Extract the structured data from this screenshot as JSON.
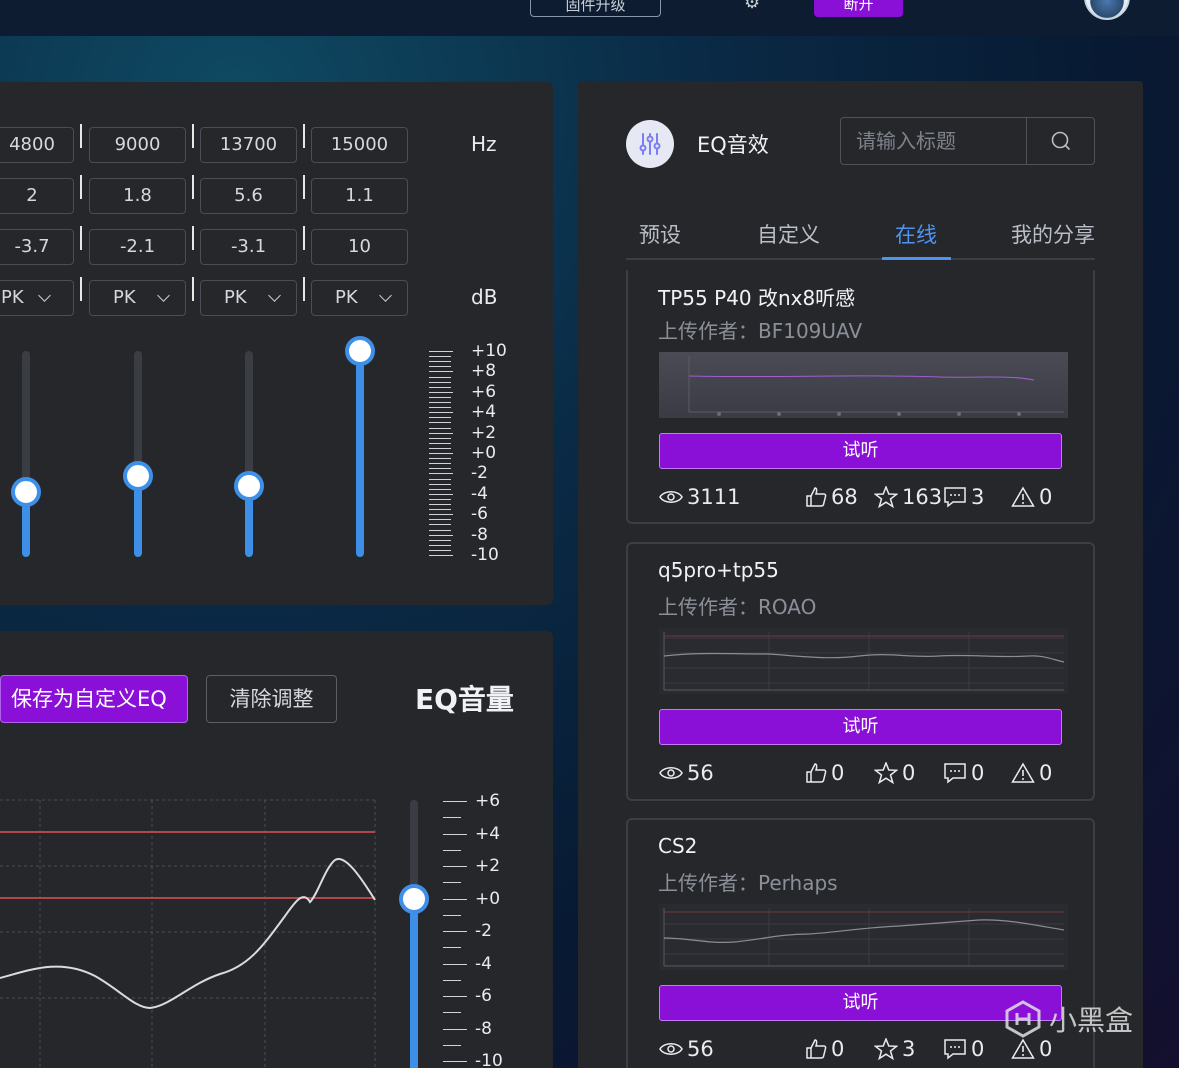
{
  "topbar": {
    "outline_button": "固件升级",
    "purple_button": "断开"
  },
  "eq": {
    "freq": [
      "4800",
      "9000",
      "13700",
      "15000"
    ],
    "q": [
      "2",
      "1.8",
      "5.6",
      "1.1"
    ],
    "gain": [
      "-3.7",
      "-2.1",
      "-3.1",
      "10"
    ],
    "type": [
      "PK",
      "PK",
      "PK",
      "PK"
    ],
    "unit_hz": "Hz",
    "unit_db": "dB",
    "slider_values_db": [
      -3.7,
      -2.1,
      -3.1,
      10
    ],
    "scale": [
      "+10",
      "+8",
      "+6",
      "+4",
      "+2",
      "+0",
      "-2",
      "-4",
      "-6",
      "-8",
      "-10"
    ]
  },
  "volume": {
    "save_button": "保存为自定义EQ",
    "clear_button": "清除调整",
    "title": "EQ音量",
    "scale": [
      "+6",
      "+4",
      "+2",
      "+0",
      "-2",
      "-4",
      "-6",
      "-8",
      "-10"
    ],
    "slider_value_db": 0
  },
  "online": {
    "title": "EQ音效",
    "search_placeholder": "请输入标题",
    "tabs": [
      "预设",
      "自定义",
      "在线",
      "我的分享"
    ],
    "active_tab": "在线",
    "author_prefix": "上传作者：",
    "listen_label": "试听",
    "cards": [
      {
        "title": "TP55 P40 改nx8听感",
        "author": "BF109UAV",
        "views": "3111",
        "likes": "68",
        "stars": "163",
        "comments": "3",
        "reports": "0"
      },
      {
        "title": "q5pro+tp55",
        "author": "ROAO",
        "views": "56",
        "likes": "0",
        "stars": "0",
        "comments": "0",
        "reports": "0"
      },
      {
        "title": "CS2",
        "author": "Perhaps",
        "views": "56",
        "likes": "0",
        "stars": "3",
        "comments": "0",
        "reports": "0"
      }
    ]
  },
  "watermark": "小黑盒",
  "colors": {
    "accent_blue": "#3d8fe8",
    "accent_purple": "#8a10d8",
    "panel": "#26272b"
  }
}
